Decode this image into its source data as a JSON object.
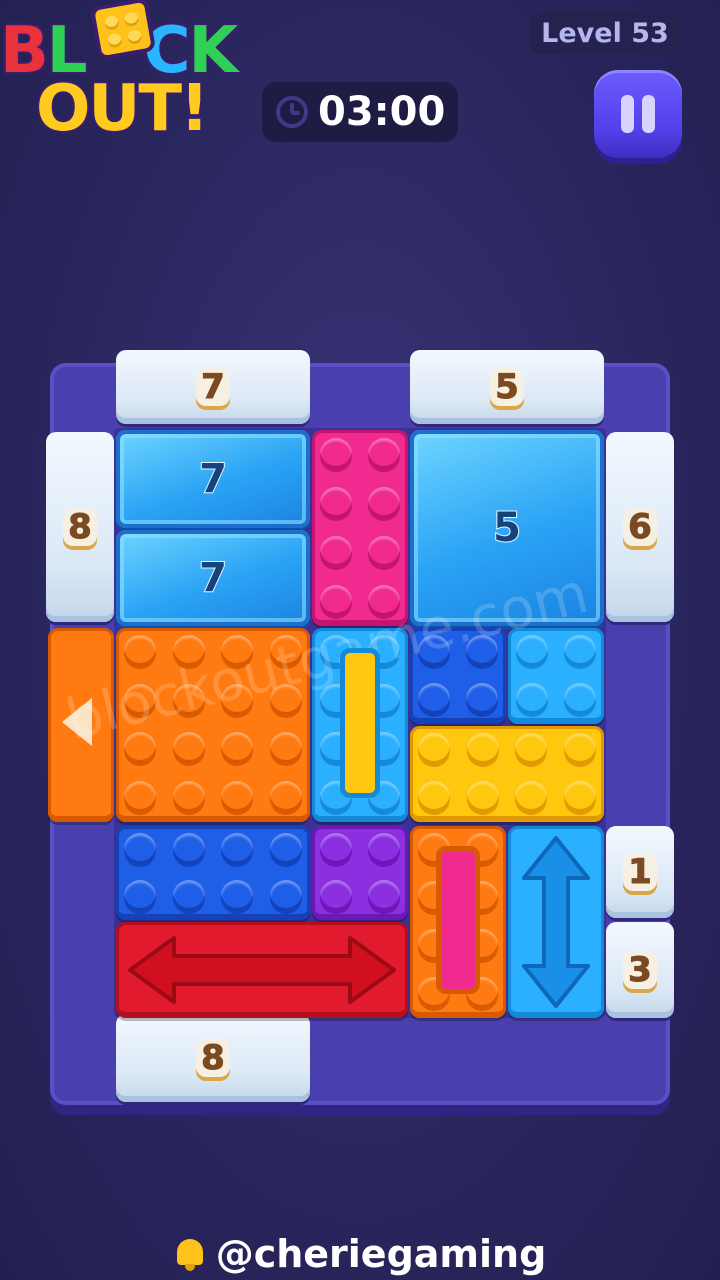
{
  "header": {
    "logo_line1": [
      "B",
      "L",
      "O",
      "C",
      "K"
    ],
    "logo_line2": "OUT!",
    "level_label": "Level 53",
    "timer": "03:00",
    "pause_icon": "pause-icon",
    "clock_icon": "clock-icon"
  },
  "gates": {
    "top_left": "7",
    "top_right": "5",
    "left_upper": "8",
    "right_upper": "6",
    "right_mid": "1",
    "right_low": "3",
    "bottom_left": "8"
  },
  "ice_blocks": {
    "left_top": "7",
    "left_bottom": "7",
    "right_big": "5"
  },
  "colors": {
    "pink": "#f02a8f",
    "orange": "#ff7a10",
    "blue": "#1f5fe8",
    "light_blue": "#2bb0ff",
    "yellow": "#ffc80f",
    "purple": "#8b2fe0",
    "red": "#e21a2d"
  },
  "watermark": "blockoutgame.com",
  "footer": {
    "handle": "@cheriegaming",
    "bell_icon": "bell-icon"
  }
}
